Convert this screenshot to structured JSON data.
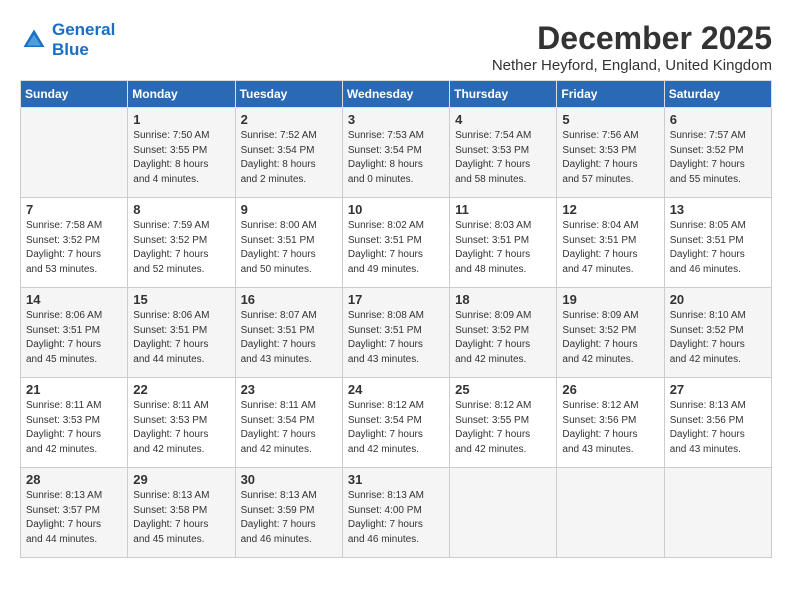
{
  "logo": {
    "line1": "General",
    "line2": "Blue"
  },
  "title": "December 2025",
  "location": "Nether Heyford, England, United Kingdom",
  "days_of_week": [
    "Sunday",
    "Monday",
    "Tuesday",
    "Wednesday",
    "Thursday",
    "Friday",
    "Saturday"
  ],
  "weeks": [
    [
      {
        "day": "",
        "info": ""
      },
      {
        "day": "1",
        "info": "Sunrise: 7:50 AM\nSunset: 3:55 PM\nDaylight: 8 hours\nand 4 minutes."
      },
      {
        "day": "2",
        "info": "Sunrise: 7:52 AM\nSunset: 3:54 PM\nDaylight: 8 hours\nand 2 minutes."
      },
      {
        "day": "3",
        "info": "Sunrise: 7:53 AM\nSunset: 3:54 PM\nDaylight: 8 hours\nand 0 minutes."
      },
      {
        "day": "4",
        "info": "Sunrise: 7:54 AM\nSunset: 3:53 PM\nDaylight: 7 hours\nand 58 minutes."
      },
      {
        "day": "5",
        "info": "Sunrise: 7:56 AM\nSunset: 3:53 PM\nDaylight: 7 hours\nand 57 minutes."
      },
      {
        "day": "6",
        "info": "Sunrise: 7:57 AM\nSunset: 3:52 PM\nDaylight: 7 hours\nand 55 minutes."
      }
    ],
    [
      {
        "day": "7",
        "info": "Sunrise: 7:58 AM\nSunset: 3:52 PM\nDaylight: 7 hours\nand 53 minutes."
      },
      {
        "day": "8",
        "info": "Sunrise: 7:59 AM\nSunset: 3:52 PM\nDaylight: 7 hours\nand 52 minutes."
      },
      {
        "day": "9",
        "info": "Sunrise: 8:00 AM\nSunset: 3:51 PM\nDaylight: 7 hours\nand 50 minutes."
      },
      {
        "day": "10",
        "info": "Sunrise: 8:02 AM\nSunset: 3:51 PM\nDaylight: 7 hours\nand 49 minutes."
      },
      {
        "day": "11",
        "info": "Sunrise: 8:03 AM\nSunset: 3:51 PM\nDaylight: 7 hours\nand 48 minutes."
      },
      {
        "day": "12",
        "info": "Sunrise: 8:04 AM\nSunset: 3:51 PM\nDaylight: 7 hours\nand 47 minutes."
      },
      {
        "day": "13",
        "info": "Sunrise: 8:05 AM\nSunset: 3:51 PM\nDaylight: 7 hours\nand 46 minutes."
      }
    ],
    [
      {
        "day": "14",
        "info": "Sunrise: 8:06 AM\nSunset: 3:51 PM\nDaylight: 7 hours\nand 45 minutes."
      },
      {
        "day": "15",
        "info": "Sunrise: 8:06 AM\nSunset: 3:51 PM\nDaylight: 7 hours\nand 44 minutes."
      },
      {
        "day": "16",
        "info": "Sunrise: 8:07 AM\nSunset: 3:51 PM\nDaylight: 7 hours\nand 43 minutes."
      },
      {
        "day": "17",
        "info": "Sunrise: 8:08 AM\nSunset: 3:51 PM\nDaylight: 7 hours\nand 43 minutes."
      },
      {
        "day": "18",
        "info": "Sunrise: 8:09 AM\nSunset: 3:52 PM\nDaylight: 7 hours\nand 42 minutes."
      },
      {
        "day": "19",
        "info": "Sunrise: 8:09 AM\nSunset: 3:52 PM\nDaylight: 7 hours\nand 42 minutes."
      },
      {
        "day": "20",
        "info": "Sunrise: 8:10 AM\nSunset: 3:52 PM\nDaylight: 7 hours\nand 42 minutes."
      }
    ],
    [
      {
        "day": "21",
        "info": "Sunrise: 8:11 AM\nSunset: 3:53 PM\nDaylight: 7 hours\nand 42 minutes."
      },
      {
        "day": "22",
        "info": "Sunrise: 8:11 AM\nSunset: 3:53 PM\nDaylight: 7 hours\nand 42 minutes."
      },
      {
        "day": "23",
        "info": "Sunrise: 8:11 AM\nSunset: 3:54 PM\nDaylight: 7 hours\nand 42 minutes."
      },
      {
        "day": "24",
        "info": "Sunrise: 8:12 AM\nSunset: 3:54 PM\nDaylight: 7 hours\nand 42 minutes."
      },
      {
        "day": "25",
        "info": "Sunrise: 8:12 AM\nSunset: 3:55 PM\nDaylight: 7 hours\nand 42 minutes."
      },
      {
        "day": "26",
        "info": "Sunrise: 8:12 AM\nSunset: 3:56 PM\nDaylight: 7 hours\nand 43 minutes."
      },
      {
        "day": "27",
        "info": "Sunrise: 8:13 AM\nSunset: 3:56 PM\nDaylight: 7 hours\nand 43 minutes."
      }
    ],
    [
      {
        "day": "28",
        "info": "Sunrise: 8:13 AM\nSunset: 3:57 PM\nDaylight: 7 hours\nand 44 minutes."
      },
      {
        "day": "29",
        "info": "Sunrise: 8:13 AM\nSunset: 3:58 PM\nDaylight: 7 hours\nand 45 minutes."
      },
      {
        "day": "30",
        "info": "Sunrise: 8:13 AM\nSunset: 3:59 PM\nDaylight: 7 hours\nand 46 minutes."
      },
      {
        "day": "31",
        "info": "Sunrise: 8:13 AM\nSunset: 4:00 PM\nDaylight: 7 hours\nand 46 minutes."
      },
      {
        "day": "",
        "info": ""
      },
      {
        "day": "",
        "info": ""
      },
      {
        "day": "",
        "info": ""
      }
    ]
  ]
}
